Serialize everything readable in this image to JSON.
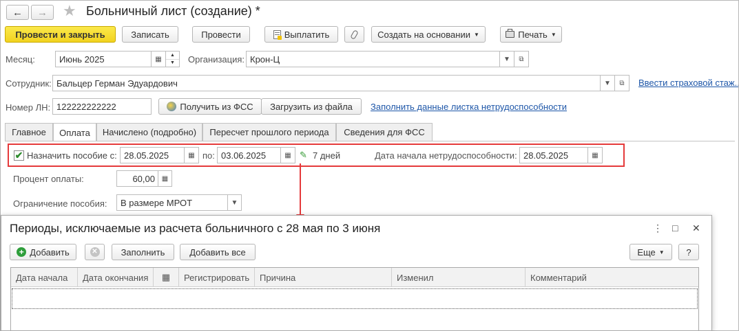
{
  "window": {
    "title": "Больничный лист (создание) *"
  },
  "nav": {
    "back": "←",
    "forward": "→",
    "star": "★"
  },
  "toolbar": {
    "post_close": "Провести и закрыть",
    "save": "Записать",
    "post": "Провести",
    "pay": "Выплатить",
    "create_based": "Создать на основании",
    "print": "Печать"
  },
  "form": {
    "month_label": "Месяц:",
    "month_value": "Июнь 2025",
    "org_label": "Организация:",
    "org_value": "Крон-Ц",
    "employee_label": "Сотрудник:",
    "employee_value": "Бальцер Герман Эдуардович",
    "insurance_link": "Ввести страховой стаж...",
    "ln_label": "Номер ЛН:",
    "ln_value": "122222222222",
    "get_fss": "Получить из ФСС",
    "load_file": "Загрузить из файла",
    "fill_link": "Заполнить данные листка нетрудоспособности"
  },
  "tabs": [
    {
      "label": "Главное"
    },
    {
      "label": "Оплата"
    },
    {
      "label": "Начислено (подробно)"
    },
    {
      "label": "Пересчет прошлого периода"
    },
    {
      "label": "Сведения для ФСС"
    }
  ],
  "payment": {
    "assign_label": "Назначить пособие с:",
    "from_value": "28.05.2025",
    "to_label": "по:",
    "to_value": "03.06.2025",
    "days": "7 дней",
    "start_label": "Дата начала нетрудоспособности:",
    "start_value": "28.05.2025",
    "percent_label": "Процент оплаты:",
    "percent_value": "60,00",
    "limit_label": "Ограничение пособия:",
    "limit_value": "В размере МРОТ"
  },
  "dialog": {
    "title": "Периоды, исключаемые из расчета больничного с 28 мая по 3 июня",
    "add": "Добавить",
    "fill": "Заполнить",
    "add_all": "Добавить все",
    "more": "Еще",
    "help": "?",
    "columns": [
      "Дата начала",
      "Дата окончания",
      "",
      "Регистрировать",
      "Причина",
      "Изменил",
      "Комментарий"
    ]
  },
  "colors": {
    "accent_yellow": "#f5dc2a",
    "link": "#1d56a8",
    "highlight_red": "#e5393a"
  }
}
